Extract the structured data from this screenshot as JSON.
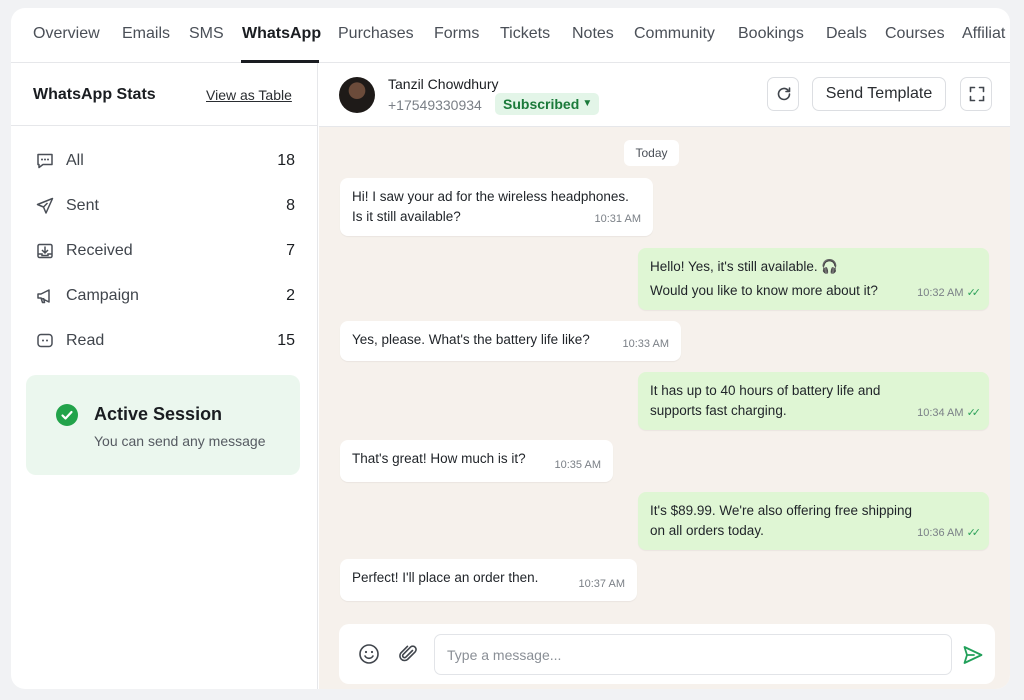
{
  "tabs": [
    {
      "label": "Overview"
    },
    {
      "label": "Emails"
    },
    {
      "label": "SMS"
    },
    {
      "label": "WhatsApp",
      "active": true
    },
    {
      "label": "Purchases"
    },
    {
      "label": "Forms"
    },
    {
      "label": "Tickets"
    },
    {
      "label": "Notes"
    },
    {
      "label": "Community"
    },
    {
      "label": "Bookings"
    },
    {
      "label": "Deals"
    },
    {
      "label": "Courses"
    },
    {
      "label": "Affiliat"
    }
  ],
  "sidebar": {
    "title": "WhatsApp Stats",
    "view_table_link": "View as Table",
    "stats": [
      {
        "label": "All",
        "count": "18",
        "icon": "message-dots-icon"
      },
      {
        "label": "Sent",
        "count": "8",
        "icon": "send-icon"
      },
      {
        "label": "Received",
        "count": "7",
        "icon": "inbox-icon"
      },
      {
        "label": "Campaign",
        "count": "2",
        "icon": "megaphone-icon"
      },
      {
        "label": "Read",
        "count": "15",
        "icon": "read-chat-icon"
      }
    ],
    "session": {
      "title": "Active Session",
      "subtitle": "You can send any message"
    }
  },
  "contact": {
    "name": "Tanzil Chowdhury",
    "phone": "+17549330934",
    "status": "Subscribed"
  },
  "header_actions": {
    "send_template_label": "Send Template"
  },
  "chat": {
    "date_divider": "Today",
    "messages": [
      {
        "direction": "in",
        "lines": [
          "Hi! I saw your ad for the wireless headphones.",
          "Is it still available?"
        ],
        "time": "10:31 AM"
      },
      {
        "direction": "out",
        "lines": [
          "Hello! Yes, it's still available. 🎧",
          "Would you like to know more about it?"
        ],
        "time": "10:32 AM",
        "read": true
      },
      {
        "direction": "in",
        "lines": [
          "Yes, please. What's the battery life like?"
        ],
        "time": "10:33 AM"
      },
      {
        "direction": "out",
        "lines": [
          "It has up to 40 hours of battery life and",
          "supports fast charging."
        ],
        "time": "10:34 AM",
        "read": true
      },
      {
        "direction": "in",
        "lines": [
          "That's great! How much is it?"
        ],
        "time": "10:35 AM"
      },
      {
        "direction": "out",
        "lines": [
          "It's $89.99. We're also offering free shipping",
          "on all orders today."
        ],
        "time": "10:36 AM",
        "read": true
      },
      {
        "direction": "in",
        "lines": [
          "Perfect! I'll place an order then."
        ],
        "time": "10:37 AM"
      }
    ]
  },
  "composer": {
    "placeholder": "Type a message..."
  },
  "colors": {
    "accent_green": "#22a34a",
    "outgoing_bubble": "#dff6d4",
    "chat_background": "#f6f1ec"
  }
}
